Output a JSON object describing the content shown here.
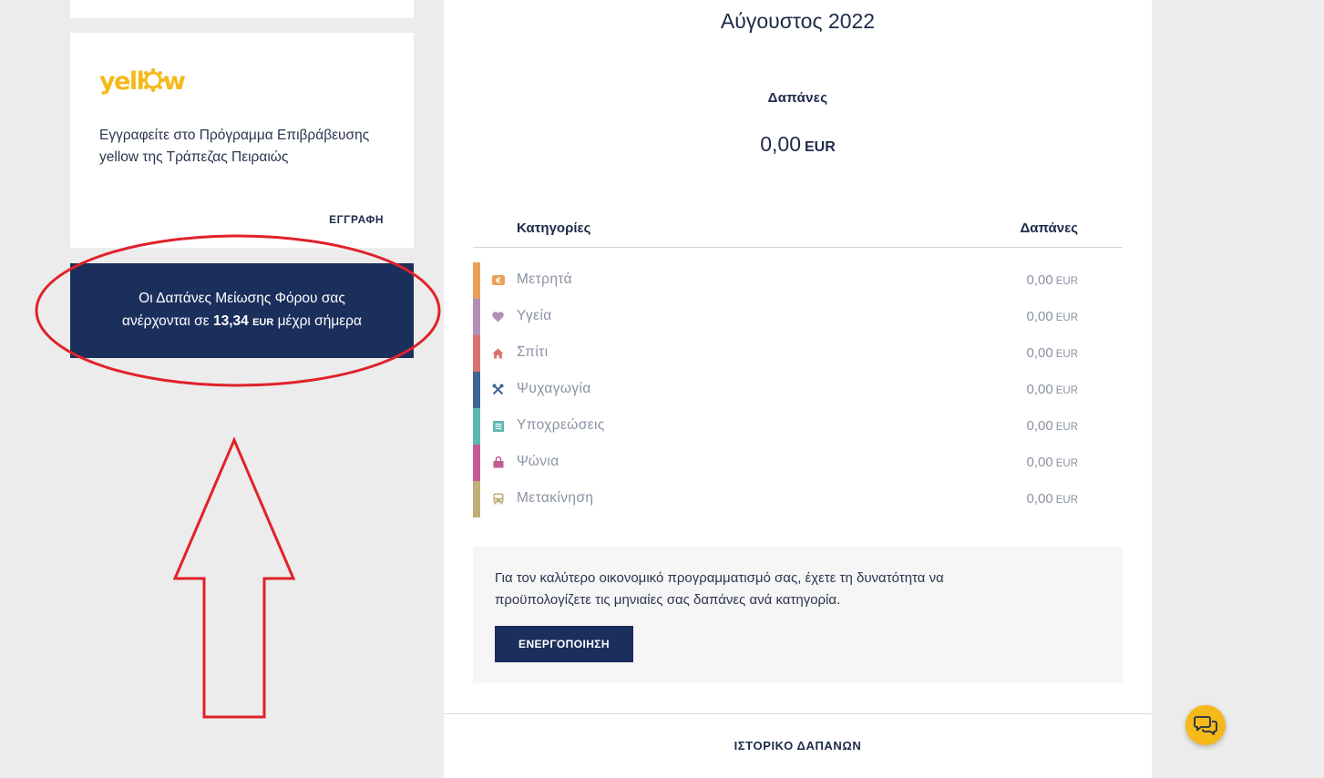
{
  "sidebar": {
    "yellow_card": {
      "logo_text": "yellow",
      "description": "Εγγραφείτε στο Πρόγραμμα Επιβράβευσης yellow της Τράπεζας Πειραιώς",
      "signup_link": "ΕΓΓΡΑΦΗ"
    },
    "tax_box": {
      "line1": "Οι Δαπάνες Μείωσης Φόρου σας",
      "line2_prefix": "ανέρχονται σε",
      "amount": "13,34",
      "currency": "EUR",
      "line2_suffix": "μέχρι σήμερα"
    }
  },
  "main": {
    "month": "Αύγουστος 2022",
    "spending_label": "Δαπάνες",
    "total_amount": "0,00",
    "total_currency": "EUR",
    "table_headers": {
      "category": "Κατηγορίες",
      "spending": "Δαπάνες"
    },
    "categories": [
      {
        "name": "Μετρητά",
        "amount": "0,00",
        "currency": "EUR",
        "color": "#e8a25a",
        "icon": "cash-icon"
      },
      {
        "name": "Υγεία",
        "amount": "0,00",
        "currency": "EUR",
        "color": "#b48fb5",
        "icon": "heart-icon"
      },
      {
        "name": "Σπίτι",
        "amount": "0,00",
        "currency": "EUR",
        "color": "#d7736d",
        "icon": "home-icon"
      },
      {
        "name": "Ψυχαγωγία",
        "amount": "0,00",
        "currency": "EUR",
        "color": "#3d6597",
        "icon": "cutlery-icon"
      },
      {
        "name": "Υποχρεώσεις",
        "amount": "0,00",
        "currency": "EUR",
        "color": "#5bb8b0",
        "icon": "document-icon"
      },
      {
        "name": "Ψώνια",
        "amount": "0,00",
        "currency": "EUR",
        "color": "#c35b93",
        "icon": "shopping-bag-icon"
      },
      {
        "name": "Μετακίνηση",
        "amount": "0,00",
        "currency": "EUR",
        "color": "#bfae77",
        "icon": "bus-icon"
      }
    ],
    "budget": {
      "text": "Για τον καλύτερο οικονομικό προγραμματισμό σας, έχετε τη δυνατότητα να προϋπολογίζετε τις μηνιαίες σας δαπάνες ανά κατηγορία.",
      "button_label": "ΕΝΕΡΓΟΠΟΙΗΣΗ"
    },
    "history_link": "ΙΣΤΟΡΙΚΟ ΔΑΠΑΝΩΝ"
  },
  "colors": {
    "navy": "#1b2f5c",
    "brand_yellow": "#f5b919",
    "annotation_red": "#e0222a"
  }
}
